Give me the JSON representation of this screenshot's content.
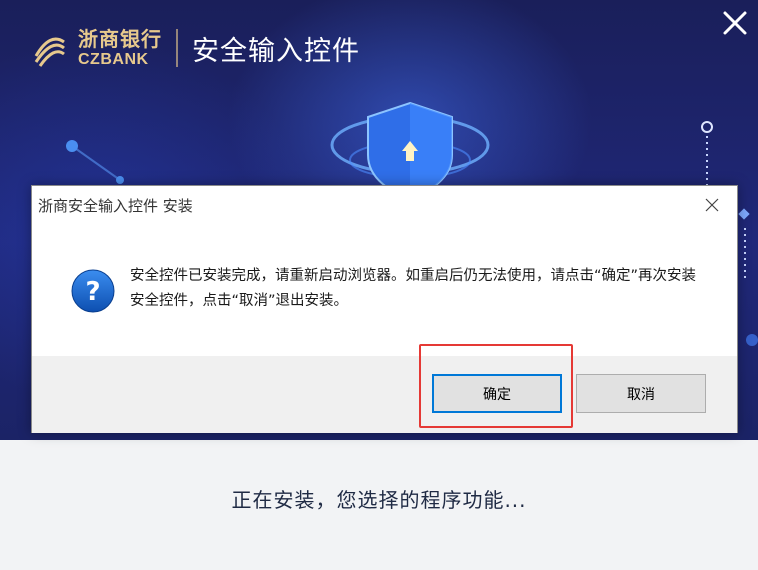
{
  "installer": {
    "brand_cn": "浙商银行",
    "brand_en": "CZBANK",
    "title": "安全输入控件",
    "status": "正在安装，您选择的程序功能...",
    "close_glyph": "✕"
  },
  "dialog": {
    "title": "浙商安全输入控件 安装",
    "close_glyph": "✕",
    "message": "安全控件已安装完成，请重新启动浏览器。如重启后仍无法使用，请点击“确定”再次安装安全控件，点击“取消”退出安装。",
    "ok_label": "确定",
    "cancel_label": "取消",
    "icon": "question-icon"
  },
  "colors": {
    "hero_bg": "#1f2670",
    "brand_gold": "#e7c98d",
    "highlight": "#e53935",
    "focus_blue": "#0078d7",
    "question_blue": "#1565c0"
  }
}
